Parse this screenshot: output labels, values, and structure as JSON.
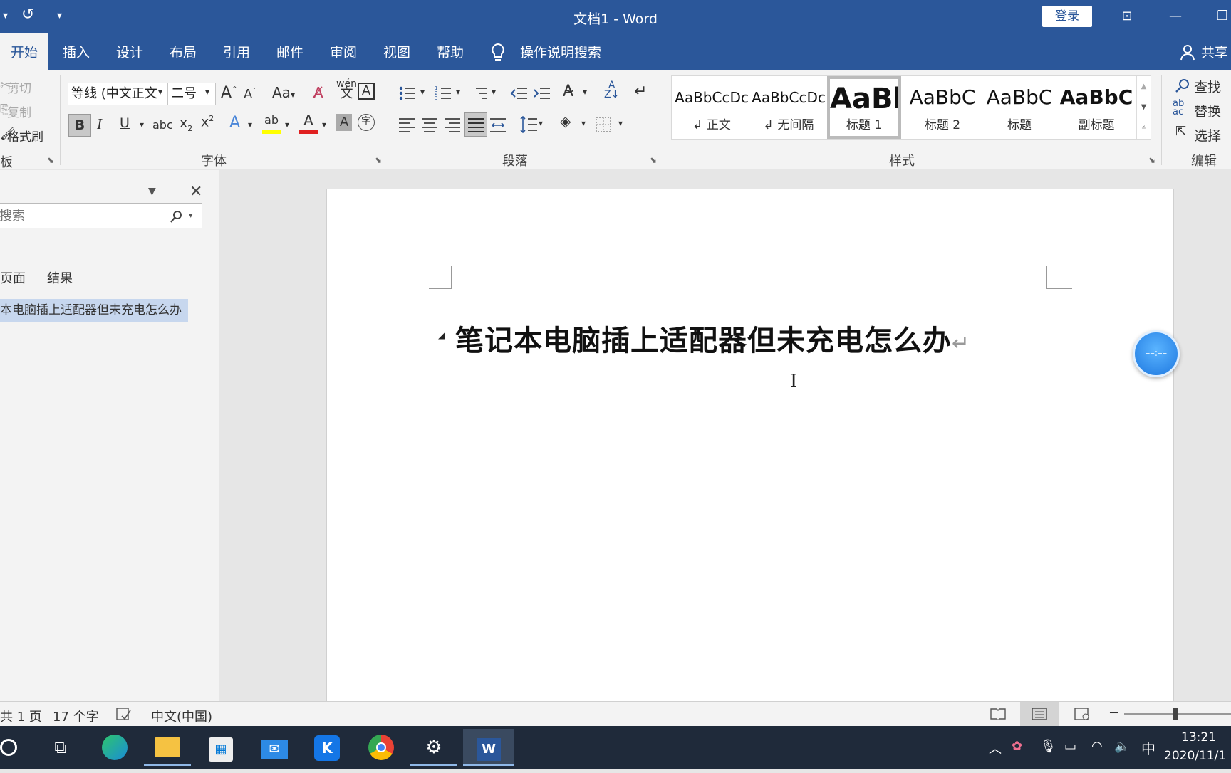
{
  "titlebar": {
    "title": "文档1  -  Word",
    "login_label": "登录",
    "undo_icon": "▾",
    "redo_icon": "↺",
    "customize_icon": "▾",
    "ribbon_display_icon": "⊡",
    "minimize_icon": "—",
    "restore_icon": "❐"
  },
  "tabs": {
    "home": "开始",
    "insert": "插入",
    "design": "设计",
    "layout": "布局",
    "references": "引用",
    "mailings": "邮件",
    "review": "审阅",
    "view": "视图",
    "help": "帮助",
    "tell_me": "操作说明搜索",
    "share": "共享"
  },
  "clipboard": {
    "cut": "剪切",
    "copy": "复制",
    "format_painter": "格式刷",
    "group_label": "板"
  },
  "font": {
    "font_name": "等线 (中文正文",
    "font_size": "二号",
    "group_label": "字体",
    "bold": "B",
    "italic": "I",
    "underline": "U",
    "strike": "abc",
    "change_case": "Aa"
  },
  "paragraph": {
    "group_label": "段落"
  },
  "styles": {
    "group_label": "样式",
    "items": [
      {
        "preview": "AaBbCcDc",
        "name": "↲ 正文"
      },
      {
        "preview": "AaBbCcDc",
        "name": "↲ 无间隔"
      },
      {
        "preview": "AaBl",
        "name": "标题 1"
      },
      {
        "preview": "AaBbC",
        "name": "标题 2"
      },
      {
        "preview": "AaBbC",
        "name": "标题"
      },
      {
        "preview": "AaBbC",
        "name": "副标题"
      }
    ]
  },
  "editing": {
    "find": "查找",
    "replace": "替换",
    "select": "选择",
    "group_label": "编辑"
  },
  "navpane": {
    "search_placeholder": "搜索",
    "tab_pages": "页面",
    "tab_results": "结果",
    "heading_item": "本电脑插上适配器但未充电怎么办"
  },
  "document": {
    "heading": "笔记本电脑插上适配器但未充电怎么办",
    "pilcrow": "↵"
  },
  "statusbar": {
    "page_info": "共 1 页",
    "word_count": "17 个字",
    "language": "中文(中国)"
  },
  "taskbar": {
    "ime": "中",
    "time": "13:21",
    "date": "2020/11/1"
  },
  "colors": {
    "word_blue": "#2b579a",
    "ribbon_bg": "#f3f3f3",
    "highlight_yellow": "#ffff00",
    "font_red": "#e02020",
    "nav_selected": "#c7d7ee"
  }
}
